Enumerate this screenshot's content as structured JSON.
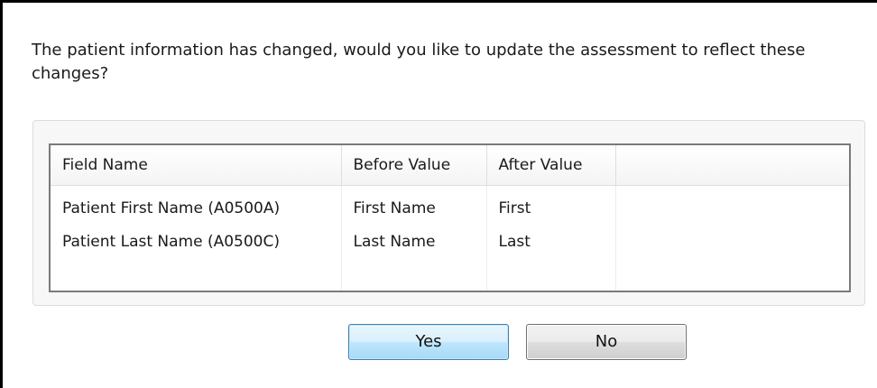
{
  "dialog": {
    "message": "The patient information has changed, would you like to update the assessment to reflect these changes?"
  },
  "table": {
    "columns": [
      "Field Name",
      "Before Value",
      "After Value",
      ""
    ],
    "rows": [
      {
        "field_name": "Patient First Name (A0500A)",
        "before_value": "First Name",
        "after_value": "First"
      },
      {
        "field_name": "Patient Last Name (A0500C)",
        "before_value": "Last Name",
        "after_value": "Last"
      }
    ]
  },
  "buttons": {
    "yes_label": "Yes",
    "no_label": "No"
  },
  "colors": {
    "dialog_border": "#000000",
    "default_button_border": "#3c7fb1",
    "default_button_fill": "#bee6fd",
    "button_border": "#707070"
  }
}
